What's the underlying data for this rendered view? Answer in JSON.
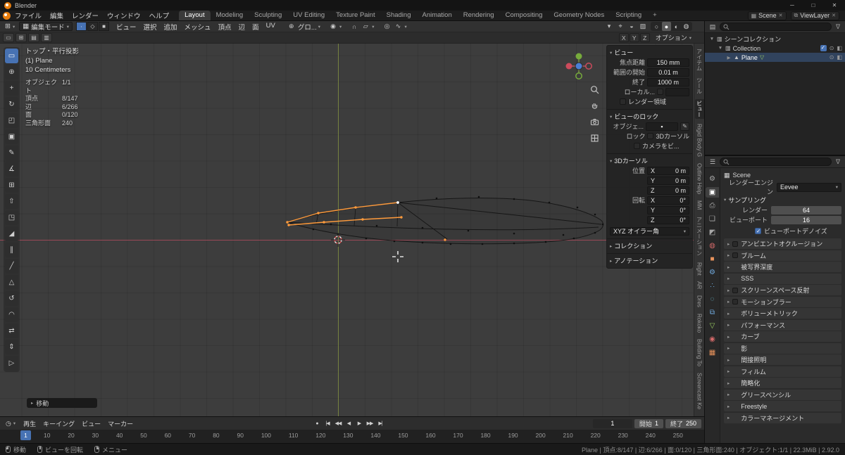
{
  "icon_glyphs": {
    "chevron_down": "▾",
    "chevron_right": "▸",
    "eye": "⊙",
    "camera": "◧",
    "funnel": "∇",
    "clock": "◷",
    "eyedropper": "✎",
    "object_field": "▪"
  },
  "window": {
    "app_title": "Blender",
    "min": "─",
    "max": "□",
    "close": "✕"
  },
  "menubar": {
    "menus": [
      "ファイル",
      "編集",
      "レンダー",
      "ウィンドウ",
      "ヘルプ"
    ],
    "workspaces": [
      {
        "label": "Layout",
        "active": true
      },
      {
        "label": "Modeling"
      },
      {
        "label": "Sculpting"
      },
      {
        "label": "UV Editing"
      },
      {
        "label": "Texture Paint"
      },
      {
        "label": "Shading"
      },
      {
        "label": "Animation"
      },
      {
        "label": "Rendering"
      },
      {
        "label": "Compositing"
      },
      {
        "label": "Geometry Nodes"
      },
      {
        "label": "Scripting"
      },
      {
        "label": "+"
      }
    ],
    "scene_selector": {
      "glyph": "▦",
      "label": "Scene"
    },
    "layer_selector": {
      "glyph": "⧉",
      "label": "ViewLayer"
    }
  },
  "vp_header": {
    "editor_glyph": "⊞",
    "mode": {
      "glyph": "▦",
      "label": "編集モード"
    },
    "select_modes": [
      {
        "name": "vertex-select-mode",
        "glyph": "∙",
        "active": true
      },
      {
        "name": "edge-select-mode",
        "glyph": "◇"
      },
      {
        "name": "face-select-mode",
        "glyph": "■"
      }
    ],
    "menus": [
      "ビュー",
      "選択",
      "追加",
      "メッシュ",
      "頂点",
      "辺",
      "面",
      "UV"
    ],
    "orientation": {
      "glyph": "⊕",
      "label": "グロ..."
    },
    "pivot_glyph": "◉",
    "snap_glyph": "∩",
    "snap_target_glyph": "▱",
    "proportional_glyph": "◎",
    "falloff_glyph": "∿",
    "right_icons": [
      {
        "name": "object-type-visibility-dropdown",
        "glyph": "▾"
      },
      {
        "name": "gizmos-toggle",
        "glyph": "⌖"
      },
      {
        "name": "overlays-toggle",
        "glyph": "◒"
      },
      {
        "name": "xray-toggle",
        "glyph": "▨"
      }
    ],
    "shading_modes": [
      {
        "name": "wireframe-shading",
        "glyph": "○"
      },
      {
        "name": "solid-shading",
        "glyph": "●",
        "active": true
      },
      {
        "name": "material-shading",
        "glyph": "◐"
      },
      {
        "name": "rendered-shading",
        "glyph": "◍"
      }
    ]
  },
  "tool_settings": {
    "left_icons": [
      {
        "name": "tweak-option",
        "glyph": "▭"
      },
      {
        "name": "active-tool-option",
        "glyph": "⊞"
      },
      {
        "name": "snap-option",
        "glyph": "▤"
      },
      {
        "name": "extras-option",
        "glyph": "▥"
      }
    ],
    "mirror_axes": [
      "X",
      "Y",
      "Z"
    ],
    "options_label": "オプション"
  },
  "viewport": {
    "view_info": [
      "トップ・平行投影",
      "(1) Plane",
      "10 Centimeters"
    ],
    "stats": [
      {
        "label": "オブジェクト",
        "value": "1/1"
      },
      {
        "label": "頂点",
        "value": "8/147"
      },
      {
        "label": "辺",
        "value": "6/266"
      },
      {
        "label": "面",
        "value": "0/120"
      },
      {
        "label": "三角形面",
        "value": "240"
      }
    ],
    "toolbar": [
      {
        "name": "select-box-tool",
        "glyph": "▭",
        "active": true
      },
      {
        "name": "cursor-tool",
        "glyph": "⊕"
      },
      {
        "name": "move-tool",
        "glyph": "+"
      },
      {
        "name": "rotate-tool",
        "glyph": "↻"
      },
      {
        "name": "scale-tool",
        "glyph": "◰"
      },
      {
        "name": "transform-tool",
        "glyph": "▣"
      },
      {
        "name": "annotate-tool",
        "glyph": "✎"
      },
      {
        "name": "measure-tool",
        "glyph": "∡"
      },
      {
        "name": "add-cube-tool",
        "glyph": "⊞"
      },
      {
        "name": "extrude-tool",
        "glyph": "⇧"
      },
      {
        "name": "inset-faces-tool",
        "glyph": "◳"
      },
      {
        "name": "bevel-tool",
        "glyph": "◢"
      },
      {
        "name": "loop-cut-tool",
        "glyph": "∥"
      },
      {
        "name": "knife-tool",
        "glyph": "╱"
      },
      {
        "name": "poly-build-tool",
        "glyph": "△"
      },
      {
        "name": "spin-tool",
        "glyph": "↺"
      },
      {
        "name": "smooth-tool",
        "glyph": "◠"
      },
      {
        "name": "edge-slide-tool",
        "glyph": "⇄"
      },
      {
        "name": "shrink-flatten-tool",
        "glyph": "⇕"
      },
      {
        "name": "rip-region-tool",
        "glyph": "▷"
      }
    ],
    "operator_panel": "移動",
    "sidebar_tabs": [
      {
        "label": "アイテム"
      },
      {
        "label": "ツール"
      },
      {
        "label": "ビュー",
        "active": true
      },
      {
        "label": "Rigid Body G"
      },
      {
        "label": "Outline Help"
      },
      {
        "label": "MM"
      },
      {
        "label": "アニメーション"
      },
      {
        "label": "Right"
      },
      {
        "label": "AR"
      },
      {
        "label": "Dres"
      },
      {
        "label": "Rokoko"
      },
      {
        "label": "Building To"
      },
      {
        "label": "Screencast Ke"
      }
    ]
  },
  "npanel": {
    "view": {
      "title": "ビュー",
      "rows": [
        {
          "label": "焦点距離",
          "value": "150 mm"
        },
        {
          "label": "範囲の開始",
          "value": "0.01 m"
        },
        {
          "label": "終了",
          "value": "1000 m"
        }
      ],
      "local_camera_label": "ローカル...",
      "render_region_label": "レンダー領域"
    },
    "view_lock": {
      "title": "ビューのロック",
      "object_label": "オブジェ...",
      "lock_label": "ロック",
      "cursor_label": "3Dカーソル",
      "camera_label": "カメラをビ..."
    },
    "cursor": {
      "title": "3Dカーソル",
      "location_label": "位置",
      "rotation_label": "回転",
      "location": [
        {
          "axis": "X",
          "value": "0 m"
        },
        {
          "axis": "Y",
          "value": "0 m"
        },
        {
          "axis": "Z",
          "value": "0 m"
        }
      ],
      "rotation": [
        {
          "axis": "X",
          "value": "0°"
        },
        {
          "axis": "Y",
          "value": "0°"
        },
        {
          "axis": "Z",
          "value": "0°"
        }
      ],
      "order": "XYZ オイラー角"
    },
    "collapsed": [
      {
        "label": "コレクション"
      },
      {
        "label": "アノテーション"
      }
    ]
  },
  "timeline": {
    "editor_glyph": "◷",
    "menus": [
      "再生",
      "キーイング",
      "ビュー",
      "マーカー"
    ],
    "transport": [
      {
        "name": "auto-key-toggle",
        "glyph": "●"
      },
      {
        "name": "jump-to-start-button",
        "glyph": "|◀"
      },
      {
        "name": "prev-keyframe-button",
        "glyph": "◀◀"
      },
      {
        "name": "play-reverse-button",
        "glyph": "◀"
      },
      {
        "name": "play-button",
        "glyph": "▶"
      },
      {
        "name": "next-keyframe-button",
        "glyph": "▶▶"
      },
      {
        "name": "jump-to-end-button",
        "glyph": "▶|"
      }
    ],
    "current_frame": "1",
    "start": {
      "label": "開始",
      "value": "1"
    },
    "end": {
      "label": "終了",
      "value": "250"
    },
    "playhead": "1",
    "ruler": [
      "10",
      "20",
      "30",
      "40",
      "50",
      "60",
      "70",
      "80",
      "90",
      "100",
      "110",
      "120",
      "130",
      "140",
      "150",
      "160",
      "170",
      "180",
      "190",
      "200",
      "210",
      "220",
      "230",
      "240",
      "250"
    ]
  },
  "outliner": {
    "editor_glyph": "▤",
    "rows": [
      {
        "ind": "ind0",
        "disclosure": "▼",
        "icon": "scene-collection-icon",
        "icon_glyph": "▥",
        "label": "シーンコレクション"
      },
      {
        "ind": "ind1",
        "disclosure": "▼",
        "icon": "collection-icon",
        "icon_glyph": "▥",
        "label": "Collection",
        "checkbox": true,
        "eye": true,
        "camera": true
      },
      {
        "ind": "ind2",
        "disclosure": "▶",
        "icon": "mesh-object-icon",
        "icon_glyph": "▲",
        "label": "Plane",
        "data_glyph": "▽",
        "selected": true,
        "eye": true,
        "camera": true
      }
    ]
  },
  "properties": {
    "editor_glyph": "☰",
    "breadcrumb": {
      "glyph": "▦",
      "label": "Scene"
    },
    "engine": {
      "label": "レンダーエンジン",
      "value": "Eevee"
    },
    "sampling": {
      "title": "サンプリング",
      "rows": [
        {
          "label": "レンダー",
          "value": "64"
        },
        {
          "label": "ビューポート",
          "value": "16"
        }
      ],
      "denoise_label": "ビューポートデノイズ"
    },
    "sections": [
      {
        "label": "アンビエントオクルージョン",
        "checkbox": true
      },
      {
        "label": "ブルーム",
        "checkbox": true
      },
      {
        "label": "被写界深度"
      },
      {
        "label": "SSS"
      },
      {
        "label": "スクリーンスペース反射",
        "checkbox": true
      },
      {
        "label": "モーションブラー",
        "checkbox": true
      },
      {
        "label": "ボリューメトリック"
      },
      {
        "label": "パフォーマンス"
      },
      {
        "label": "カーブ"
      },
      {
        "label": "影"
      },
      {
        "label": "間接照明"
      },
      {
        "label": "フィルム"
      },
      {
        "label": "簡略化"
      },
      {
        "label": "グリースペンシル"
      },
      {
        "label": "Freestyle"
      },
      {
        "label": "カラーマネージメント"
      }
    ],
    "rail": [
      {
        "name": "tool-tab",
        "glyph": "⚙"
      },
      {
        "name": "render-tab",
        "glyph": "▣",
        "active": true
      },
      {
        "name": "output-tab",
        "glyph": "⎙"
      },
      {
        "name": "view-layer-tab",
        "glyph": "❏"
      },
      {
        "name": "scene-tab",
        "glyph": "◩"
      },
      {
        "name": "world-tab",
        "glyph": "◍",
        "cls": "c-red"
      },
      {
        "name": "object-tab",
        "glyph": "■",
        "cls": "c-orange"
      },
      {
        "name": "modifiers-tab",
        "glyph": "⚙",
        "cls": "c-blue"
      },
      {
        "name": "particles-tab",
        "glyph": "∴",
        "cls": "c-blue"
      },
      {
        "name": "physics-tab",
        "glyph": "◌",
        "cls": "c-cyan"
      },
      {
        "name": "constraints-tab",
        "glyph": "⧉",
        "cls": "c-blue"
      },
      {
        "name": "object-data-tab",
        "glyph": "▽",
        "cls": "c-green"
      },
      {
        "name": "material-tab",
        "glyph": "◉",
        "cls": "c-red"
      },
      {
        "name": "texture-tab",
        "glyph": "▦",
        "cls": "c-orange"
      }
    ]
  },
  "statusbar": {
    "hints": [
      {
        "icon": "mouse-left-drag-icon",
        "mcls": "m-l",
        "label": "移動"
      },
      {
        "icon": "mouse-middle-icon",
        "mcls": "m-m",
        "label": "ビューを回転"
      },
      {
        "icon": "mouse-right-icon",
        "mcls": "m-r",
        "label": "メニュー"
      }
    ],
    "info": "Plane | 頂点:8/147 | 辺:6/266 | 面:0/120 | 三角形面:240 | オブジェクト:1/1 | 22.3MiB | 2.92.0"
  },
  "colors": {
    "accent": "#4772b3",
    "selection_orange": "#ff9b3c",
    "axis_x": "#9e4a58",
    "axis_y": "#7a8742",
    "viewport_bg": "#3d3d3d"
  }
}
